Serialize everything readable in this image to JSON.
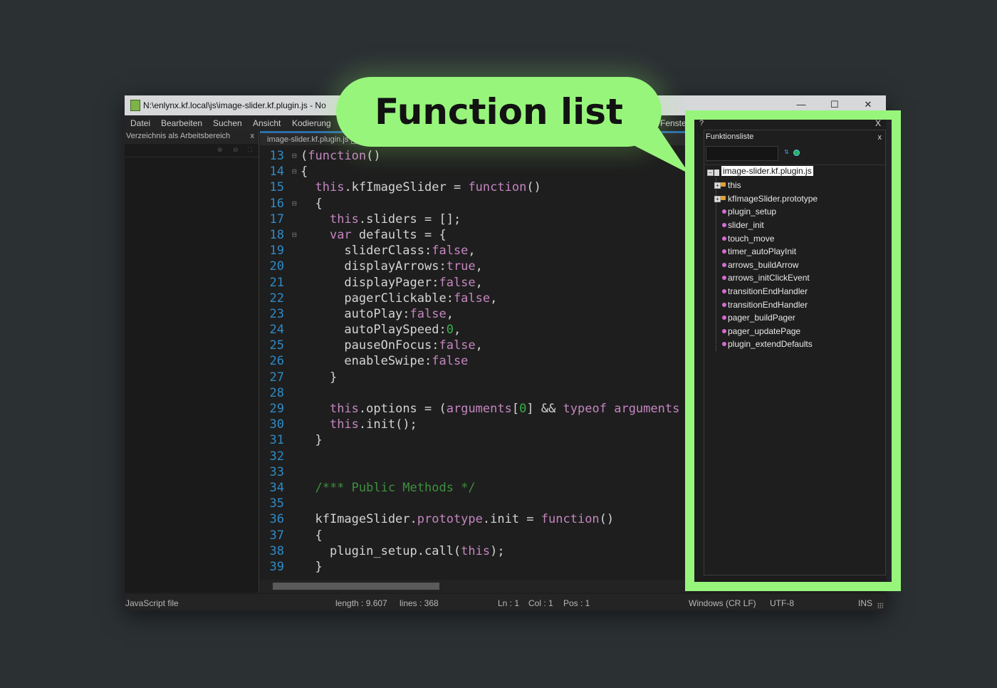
{
  "window": {
    "title": "N:\\enlynx.kf.local\\js\\image-slider.kf.plugin.js - No",
    "controls": {
      "minimize": "—",
      "maximize": "☐",
      "close": "✕"
    }
  },
  "menu": {
    "items": [
      "Datei",
      "Bearbeiten",
      "Suchen",
      "Ansicht",
      "Kodierung"
    ],
    "window_menu": "Fenste"
  },
  "left_panel": {
    "title": "Verzeichnis als Arbeitsbereich",
    "close": "x"
  },
  "editor": {
    "tab_label": "image-slider.kf.plugin.js"
  },
  "code_lines": [
    {
      "n": "13",
      "f": "⊟",
      "t": "(function()"
    },
    {
      "n": "14",
      "f": "⊟",
      "t": "{"
    },
    {
      "n": "15",
      "f": "",
      "t": "  this.kfImageSlider = function()"
    },
    {
      "n": "16",
      "f": "⊟",
      "t": "  {"
    },
    {
      "n": "17",
      "f": "",
      "t": "    this.sliders = [];"
    },
    {
      "n": "18",
      "f": "⊟",
      "t": "    var defaults = {"
    },
    {
      "n": "19",
      "f": "",
      "t": "      sliderClass:false,"
    },
    {
      "n": "20",
      "f": "",
      "t": "      displayArrows:true,"
    },
    {
      "n": "21",
      "f": "",
      "t": "      displayPager:false,"
    },
    {
      "n": "22",
      "f": "",
      "t": "      pagerClickable:false,"
    },
    {
      "n": "23",
      "f": "",
      "t": "      autoPlay:false,"
    },
    {
      "n": "24",
      "f": "",
      "t": "      autoPlaySpeed:0,"
    },
    {
      "n": "25",
      "f": "",
      "t": "      pauseOnFocus:false,"
    },
    {
      "n": "26",
      "f": "",
      "t": "      enableSwipe:false"
    },
    {
      "n": "27",
      "f": "",
      "t": "    }"
    },
    {
      "n": "28",
      "f": "",
      "t": ""
    },
    {
      "n": "29",
      "f": "",
      "t": "    this.options = (arguments[0] && typeof arguments"
    },
    {
      "n": "30",
      "f": "",
      "t": "    this.init();"
    },
    {
      "n": "31",
      "f": "",
      "t": "  }"
    },
    {
      "n": "32",
      "f": "",
      "t": ""
    },
    {
      "n": "33",
      "f": "",
      "t": ""
    },
    {
      "n": "34",
      "f": "",
      "t": "  /*** Public Methods */"
    },
    {
      "n": "35",
      "f": "",
      "t": ""
    },
    {
      "n": "36",
      "f": "",
      "t": "  kfImageSlider.prototype.init = function()"
    },
    {
      "n": "37",
      "f": "",
      "t": "  {"
    },
    {
      "n": "38",
      "f": "",
      "t": "    plugin_setup.call(this);"
    },
    {
      "n": "39",
      "f": "",
      "t": "  }"
    }
  ],
  "function_list": {
    "outer_help": "?",
    "outer_close": "X",
    "title": "Funktionsliste",
    "close": "x",
    "search_value": "",
    "root": "image-slider.kf.plugin.js",
    "classes": [
      "this",
      "kfImageSlider.prototype"
    ],
    "functions": [
      "plugin_setup",
      "slider_init",
      "touch_move",
      "timer_autoPlayInit",
      "arrows_buildArrow",
      "arrows_initClickEvent",
      "transitionEndHandler",
      "transitionEndHandler",
      "pager_buildPager",
      "pager_updatePage",
      "plugin_extendDefaults"
    ]
  },
  "statusbar": {
    "file_type": "JavaScript file",
    "length": "length : 9.607",
    "lines": "lines : 368",
    "ln": "Ln : 1",
    "col": "Col : 1",
    "pos": "Pos : 1",
    "eol": "Windows (CR LF)",
    "encoding": "UTF-8",
    "mode": "INS"
  },
  "annotation": {
    "label": "Function list",
    "color": "#98f57c"
  },
  "colors": {
    "background": "#2b3033",
    "line_numbers": "#2f8bc7",
    "keyword": "#c586c0",
    "number": "#39b04a",
    "comment": "#3f8f3f"
  }
}
